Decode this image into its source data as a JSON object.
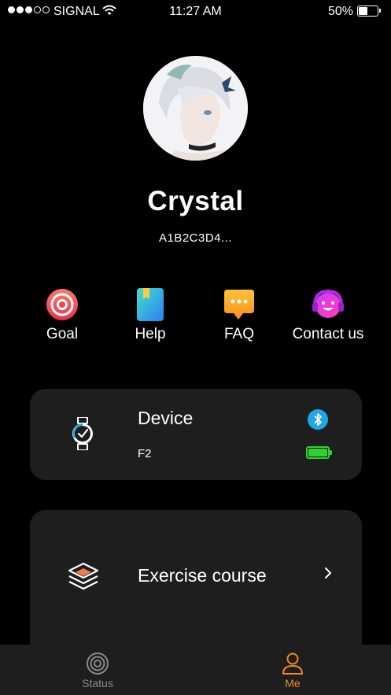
{
  "status_bar": {
    "carrier": "SIGNAL",
    "time": "11:27 AM",
    "battery_percent": "50%",
    "battery_level": 0.5,
    "signal_bars": 3,
    "signal_total": 5
  },
  "profile": {
    "name": "Crystal",
    "user_id": "A1B2C3D4..."
  },
  "shortcuts": [
    {
      "label": "Goal",
      "icon": "target-icon"
    },
    {
      "label": "Help",
      "icon": "book-icon"
    },
    {
      "label": "FAQ",
      "icon": "chat-bubble-icon"
    },
    {
      "label": "Contact us",
      "icon": "headset-icon"
    }
  ],
  "device_card": {
    "title": "Device",
    "model": "F2",
    "bluetooth_icon": "bluetooth-icon",
    "battery_level": 1.0
  },
  "exercise_card": {
    "title": "Exercise course"
  },
  "tab_bar": {
    "tabs": [
      {
        "label": "Status",
        "active": false
      },
      {
        "label": "Me",
        "active": true
      }
    ]
  },
  "colors": {
    "background": "#000000",
    "card": "#1e1e1e",
    "accent_active": "#f08a1e",
    "tab_inactive": "#8a8a8a",
    "battery_green": "#2fd12f",
    "bluetooth_blue": "#1fa6e8"
  }
}
